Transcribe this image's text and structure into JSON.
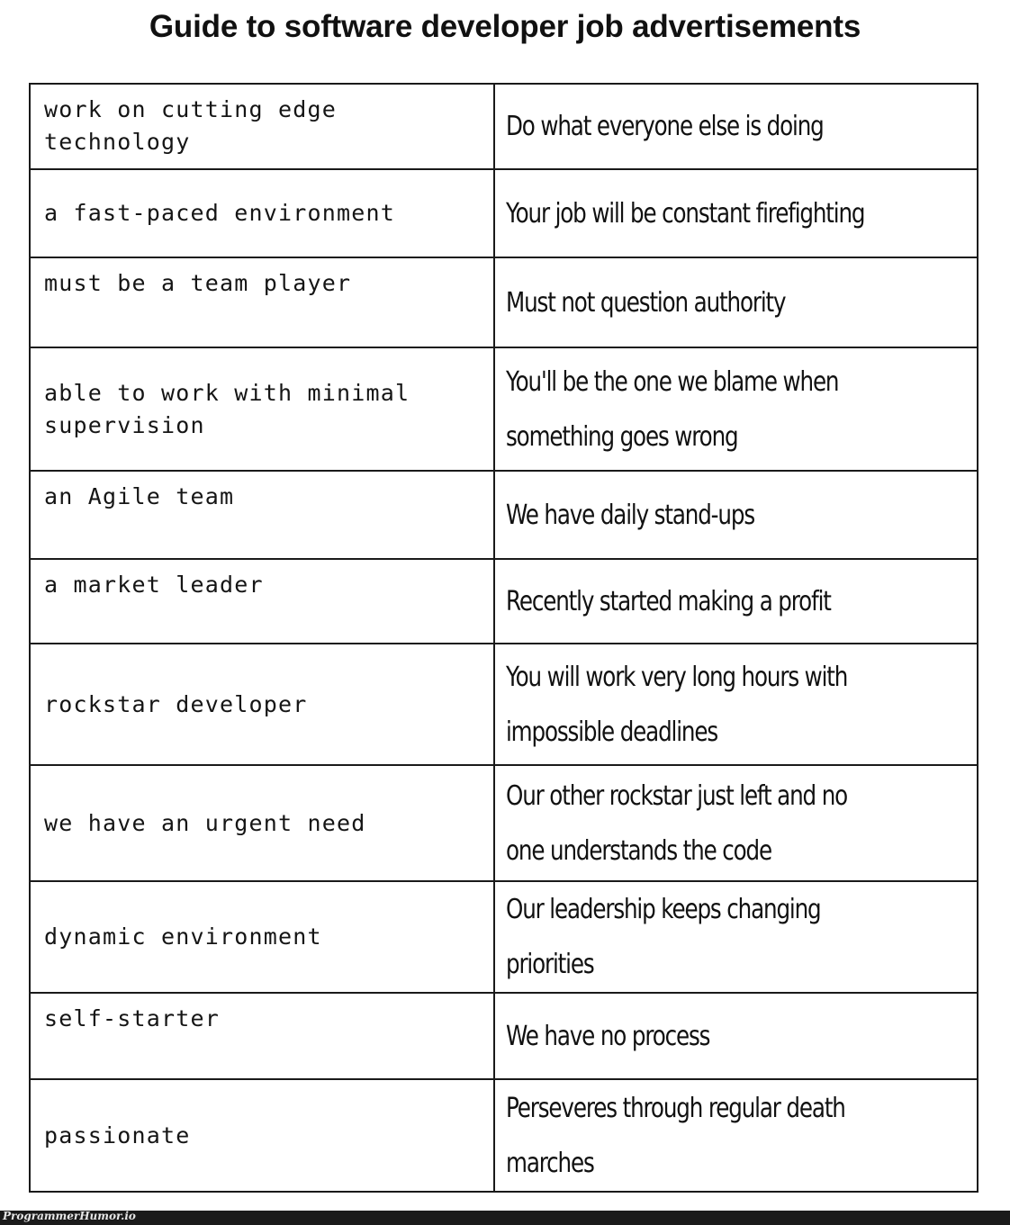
{
  "title": "Guide to software developer job advertisements",
  "rows": [
    {
      "phrase": "work on cutting edge technology",
      "meaning": [
        "Do what everyone else is doing"
      ]
    },
    {
      "phrase": "a fast-paced environment",
      "meaning": [
        "Your job will be constant firefighting"
      ]
    },
    {
      "phrase": "must be a team player",
      "meaning": [
        "Must not question authority"
      ]
    },
    {
      "phrase": "able to work with minimal supervision",
      "meaning": [
        "You'll be the one we blame when",
        "something goes wrong"
      ]
    },
    {
      "phrase": "an Agile team",
      "meaning": [
        "We have daily stand-ups"
      ]
    },
    {
      "phrase": "a market leader",
      "meaning": [
        "Recently started making a profit"
      ]
    },
    {
      "phrase": "rockstar developer",
      "meaning": [
        "You will work very long hours with",
        "impossible deadlines"
      ]
    },
    {
      "phrase": "we have an urgent need",
      "meaning": [
        "Our other rockstar just left and no",
        "one understands the code"
      ]
    },
    {
      "phrase": "dynamic environment",
      "meaning": [
        "Our leadership keeps changing",
        "priorities"
      ]
    },
    {
      "phrase": "self-starter",
      "meaning": [
        "We have no process"
      ]
    },
    {
      "phrase": "passionate",
      "meaning": [
        "Perseveres through regular death",
        "marches"
      ]
    }
  ],
  "footer": {
    "watermark": "ProgrammerHumor.io"
  }
}
